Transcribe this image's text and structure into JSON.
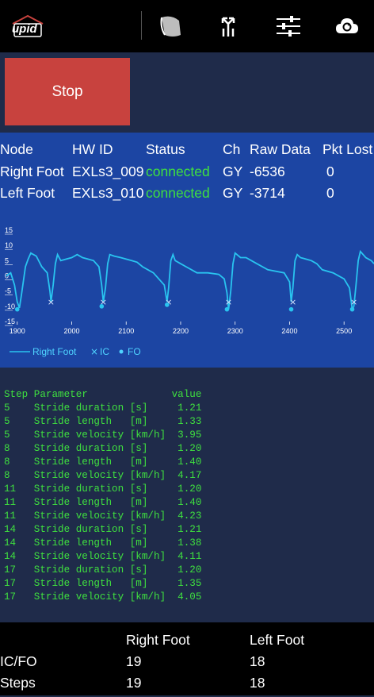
{
  "app": {
    "logo_text": "upid"
  },
  "toolbar": {
    "icons": [
      "logo-house-icon",
      "shoe-icon",
      "split-arrows-icon",
      "sliders-icon",
      "cloud-sync-icon"
    ]
  },
  "controls": {
    "stop_label": "Stop",
    "stop_color": "#c8423e"
  },
  "nodes": {
    "headers": [
      "Node",
      "HW ID",
      "Status",
      "Ch",
      "Raw Data",
      "Pkt Lost"
    ],
    "rows": [
      {
        "node": "Right Foot",
        "hw_id": "EXLs3_009",
        "status": "connected",
        "ch": "GY",
        "raw": "-6536",
        "lost": "0"
      },
      {
        "node": "Left Foot",
        "hw_id": "EXLs3_010",
        "status": "connected",
        "ch": "GY",
        "raw": "-3714",
        "lost": "0"
      }
    ]
  },
  "chart_data": {
    "type": "line",
    "x_ticks": [
      "1900",
      "2000",
      "2100",
      "2200",
      "2300",
      "2400",
      "2500"
    ],
    "y_ticks": [
      "15",
      "10",
      "5",
      "0",
      "-5",
      "-10",
      "-15"
    ],
    "xlim": [
      1880,
      2555
    ],
    "ylim": [
      -15,
      15
    ],
    "legend": {
      "placement": "bottom-left",
      "items": [
        "Right Foot",
        "IC",
        "FO"
      ]
    },
    "series": [
      {
        "name": "Right Foot",
        "color": "#29c4f0",
        "x": [
          1880,
          1888,
          1895,
          1900,
          1904,
          1908,
          1915,
          1920,
          1925,
          1935,
          1945,
          1955,
          1960,
          1962,
          1966,
          1970,
          1974,
          1980,
          1990,
          2000,
          2010,
          2020,
          2030,
          2040,
          2050,
          2055,
          2058,
          2062,
          2066,
          2070,
          2078,
          2090,
          2100,
          2110,
          2120,
          2130,
          2150,
          2170,
          2175,
          2178,
          2182,
          2186,
          2190,
          2200,
          2210,
          2220,
          2230,
          2250,
          2270,
          2280,
          2285,
          2288,
          2292,
          2296,
          2300,
          2310,
          2320,
          2330,
          2340,
          2360,
          2390,
          2400,
          2403,
          2406,
          2410,
          2414,
          2420,
          2430,
          2440,
          2450,
          2460,
          2480,
          2500,
          2510,
          2515,
          2518,
          2522,
          2526,
          2530,
          2540,
          2550,
          2555
        ],
        "y": [
          0,
          1,
          -3,
          -8.5,
          -10.5,
          -6,
          3,
          5.5,
          7.5,
          6.5,
          3,
          1,
          -5,
          -8.5,
          -3,
          4,
          7,
          5,
          5.5,
          6,
          7,
          6,
          5.5,
          5,
          3,
          -3,
          -8.5,
          -4,
          4,
          7,
          6.5,
          6,
          5.5,
          5,
          4.5,
          3,
          1,
          -3,
          -8.5,
          -4,
          5,
          7,
          5,
          4,
          3,
          2,
          1,
          1,
          0.5,
          -1,
          -5.5,
          -11,
          -5,
          4,
          7.5,
          6,
          6,
          5,
          4,
          2,
          1,
          -2,
          -8.5,
          -4,
          5,
          7,
          6,
          5.5,
          5,
          4,
          2,
          1,
          -1,
          -4,
          -11,
          -10,
          -3,
          5,
          8,
          6,
          5,
          4
        ]
      },
      {
        "name": "IC",
        "marker": "x",
        "x": [
          1962,
          2058,
          2178,
          2288,
          2406,
          2518
        ],
        "y": [
          -8.5,
          -8.5,
          -8.5,
          -8.5,
          -8.5,
          -8.5
        ]
      },
      {
        "name": "FO",
        "marker": "dot",
        "x": [
          1900,
          2055,
          2175,
          2285,
          2403,
          2515
        ],
        "y": [
          -11,
          -10,
          -9.5,
          -11,
          -11,
          -11
        ]
      }
    ]
  },
  "gait_params": {
    "headers": [
      "Step",
      "Parameter",
      "value"
    ],
    "rows": [
      {
        "step": "5",
        "parameter": "Stride duration [s]",
        "value": "1.21"
      },
      {
        "step": "5",
        "parameter": "Stride length   [m]",
        "value": "1.33"
      },
      {
        "step": "5",
        "parameter": "Stride velocity [km/h]",
        "value": "3.95"
      },
      {
        "step": "8",
        "parameter": "Stride duration [s]",
        "value": "1.20"
      },
      {
        "step": "8",
        "parameter": "Stride length   [m]",
        "value": "1.40"
      },
      {
        "step": "8",
        "parameter": "Stride velocity [km/h]",
        "value": "4.17"
      },
      {
        "step": "11",
        "parameter": "Stride duration [s]",
        "value": "1.20"
      },
      {
        "step": "11",
        "parameter": "Stride length   [m]",
        "value": "1.40"
      },
      {
        "step": "11",
        "parameter": "Stride velocity [km/h]",
        "value": "4.23"
      },
      {
        "step": "14",
        "parameter": "Stride duration [s]",
        "value": "1.21"
      },
      {
        "step": "14",
        "parameter": "Stride length   [m]",
        "value": "1.38"
      },
      {
        "step": "14",
        "parameter": "Stride velocity [km/h]",
        "value": "4.11"
      },
      {
        "step": "17",
        "parameter": "Stride duration [s]",
        "value": "1.20"
      },
      {
        "step": "17",
        "parameter": "Stride length   [m]",
        "value": "1.35"
      },
      {
        "step": "17",
        "parameter": "Stride velocity [km/h]",
        "value": "4.05"
      }
    ]
  },
  "summary": {
    "headers": [
      "",
      "Right Foot",
      "Left Foot"
    ],
    "rows": [
      {
        "label": "IC/FO",
        "right": "19",
        "left": "18"
      },
      {
        "label": "Steps",
        "right": "19",
        "left": "18"
      }
    ]
  }
}
